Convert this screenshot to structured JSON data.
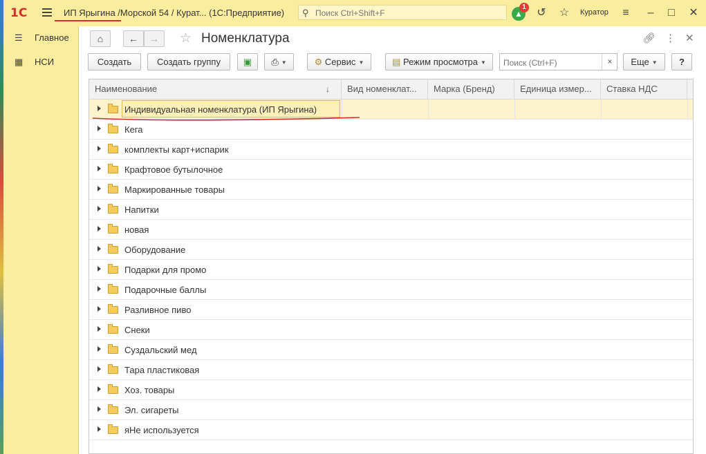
{
  "titlebar": {
    "logo": "1С",
    "title": "ИП Ярыгина /Морской 54 / Курат...  (1С:Предприятие)",
    "search_placeholder": "Поиск Ctrl+Shift+F",
    "notification_count": "1",
    "user": "Куратор"
  },
  "sidebar": {
    "items": [
      {
        "label": "Главное",
        "icon": "menu-lines-icon"
      },
      {
        "label": "НСИ",
        "icon": "catalog-icon"
      }
    ]
  },
  "form": {
    "title": "Номенклатура"
  },
  "toolbar": {
    "create": "Создать",
    "create_group": "Создать группу",
    "service": "Сервис",
    "view_mode": "Режим просмотра",
    "search_placeholder": "Поиск (Ctrl+F)",
    "search_clear": "×",
    "more": "Еще",
    "help": "?"
  },
  "table": {
    "columns": [
      "Наименование",
      "Вид номенклат...",
      "Марка (Бренд)",
      "Единица измер...",
      "Ставка НДС"
    ],
    "rows": [
      "Индивидуальная номенклатура (ИП Ярыгина)",
      "Кега",
      "комплекты карт+испарик",
      "Крафтовое бутылочное",
      "Маркированные товары",
      "Напитки",
      "новая",
      "Оборудование",
      "Подарки для промо",
      "Подарочные баллы",
      "Разливное пиво",
      "Снеки",
      "Суздальский мед",
      "Тара пластиковая",
      "Хоз. товары",
      "Эл. сигареты",
      "яНе используется"
    ],
    "selected_index": 0
  },
  "colors": {
    "panel": "#fbed9e",
    "selection": "#fcf3cc",
    "annotation": "#d32f2f"
  }
}
